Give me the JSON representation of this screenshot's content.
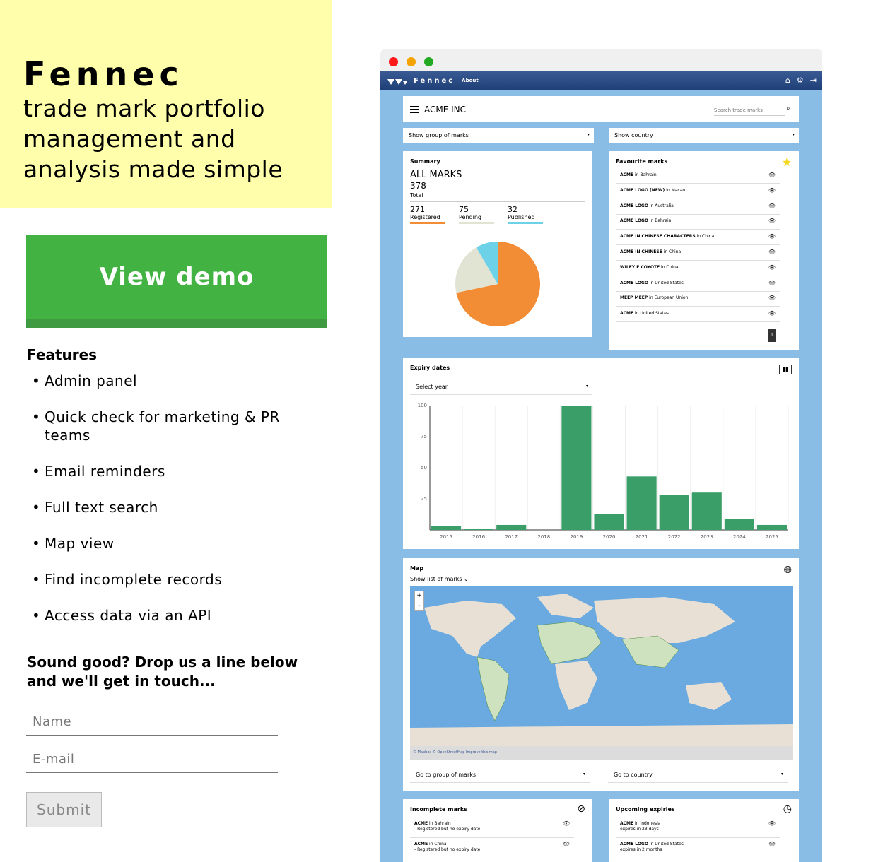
{
  "hero": {
    "brand": "Fennec",
    "tagline": "trade mark portfolio management and analysis made simple"
  },
  "demo_button": "View demo",
  "features": {
    "title": "Features",
    "items": [
      "Admin panel",
      "Quick check for marketing & PR teams",
      "Email reminders",
      "Full text search",
      "Map view",
      "Find incomplete records",
      "Access data via an API"
    ]
  },
  "contact": {
    "cta": "Sound good? Drop us a line below and we'll get in touch...",
    "name_placeholder": "Name",
    "email_placeholder": "E-mail",
    "submit_label": "Submit"
  },
  "browser": {
    "dot_colors": [
      "#ff1a1a",
      "#f4a400",
      "#22aa22"
    ],
    "app_name": "Fennec",
    "about": "About",
    "nav_icons": [
      "home-icon",
      "gear-icon",
      "logout-icon"
    ],
    "account": "ACME INC",
    "search_placeholder": "Search trade marks",
    "group_select": "Show group of marks",
    "country_select": "Show country",
    "summary": {
      "title": "Summary",
      "all_label": "ALL MARKS",
      "total": "378",
      "total_label": "Total",
      "stats": [
        {
          "value": "271",
          "label": "Registered",
          "color": "#f28c35"
        },
        {
          "value": "75",
          "label": "Pending",
          "color": "#e2e4d3"
        },
        {
          "value": "32",
          "label": "Published",
          "color": "#6dd1e8"
        }
      ]
    },
    "favourites": {
      "title": "Favourite marks",
      "items": [
        {
          "mark": "ACME",
          "country": "in Bahrain"
        },
        {
          "mark": "ACME LOGO (NEW)",
          "country": "in Macao"
        },
        {
          "mark": "ACME LOGO",
          "country": "in Australia"
        },
        {
          "mark": "ACME LOGO",
          "country": "in Bahrain"
        },
        {
          "mark": "ACME IN CHINESE CHARACTERS",
          "country": "in China"
        },
        {
          "mark": "ACME IN CHINESE",
          "country": "in China"
        },
        {
          "mark": "WILEY E COYOTE",
          "country": "in China"
        },
        {
          "mark": "ACME LOGO",
          "country": "in United States"
        },
        {
          "mark": "MEEP MEEP",
          "country": "in European Union"
        },
        {
          "mark": "ACME",
          "country": "in United States"
        }
      ],
      "page": "1"
    },
    "expiry": {
      "title": "Expiry dates",
      "select_year": "Select year"
    },
    "map": {
      "title": "Map",
      "show_list": "Show list of marks",
      "credit": "© Mapbox © OpenStreetMap Improve this map",
      "goto_group": "Go to group of marks",
      "goto_country": "Go to country",
      "zoom_in": "+",
      "zoom_out": "-"
    },
    "incomplete": {
      "title": "Incomplete marks",
      "items": [
        {
          "mark": "ACME",
          "country": "in Bahrain",
          "note": "- Registered but no expiry date"
        },
        {
          "mark": "ACME",
          "country": "in China",
          "note": "- Registered but no expiry date"
        }
      ]
    },
    "upcoming": {
      "title": "Upcoming expiries",
      "items": [
        {
          "mark": "ACME",
          "country": "in Indonesia",
          "note": "expires in 23 days"
        },
        {
          "mark": "ACME LOGO",
          "country": "in United States",
          "note": "expires in 2 months"
        }
      ]
    }
  },
  "chart_data": [
    {
      "type": "pie",
      "categories": [
        "Registered",
        "Pending",
        "Published"
      ],
      "values": [
        271,
        75,
        32
      ],
      "colors": [
        "#f28c35",
        "#e2e4d3",
        "#6dd1e8"
      ]
    },
    {
      "type": "bar",
      "categories": [
        "2015",
        "2016",
        "2017",
        "2018",
        "2019",
        "2020",
        "2021",
        "2022",
        "2023",
        "2024",
        "2025"
      ],
      "values": [
        3,
        1,
        4,
        0,
        100,
        13,
        43,
        28,
        30,
        9,
        4
      ],
      "ylim": [
        0,
        100
      ],
      "yticks": [
        25,
        50,
        75,
        100
      ],
      "grid": true,
      "color": "#3a9e68"
    }
  ]
}
